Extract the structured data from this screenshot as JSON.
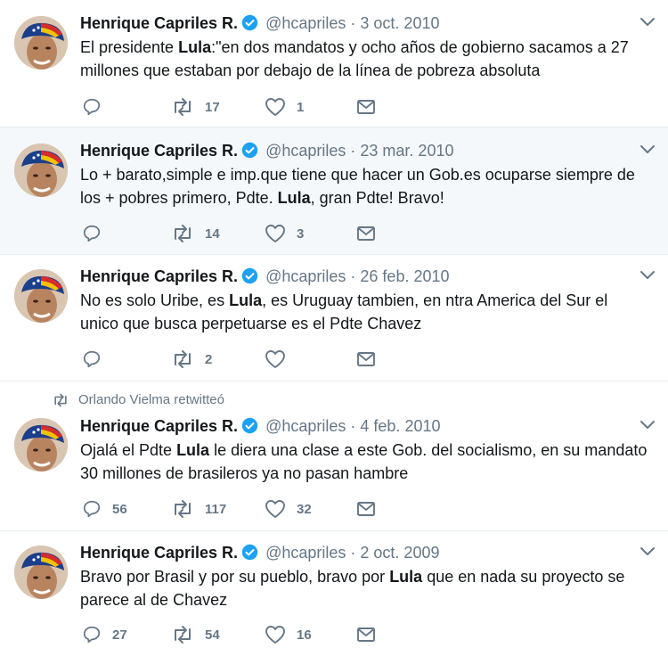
{
  "feed": {
    "retweet_context": "Orlando Vielma retwitteó",
    "tweets": [
      {
        "name": "Henrique Capriles R.",
        "handle": "@hcapriles",
        "separator": "·",
        "date": "3 oct. 2010",
        "text_parts": [
          "El presidente ",
          "Lula",
          ":\"en dos mandatos y ocho años de gobierno sacamos a 27 millones que estaban por debajo de la línea de pobreza absoluta"
        ],
        "replies": "",
        "retweets": "17",
        "likes": "1"
      },
      {
        "name": "Henrique Capriles R.",
        "handle": "@hcapriles",
        "separator": "·",
        "date": "23 mar. 2010",
        "text_parts": [
          "Lo + barato,simple e imp.que tiene que hacer un Gob.es ocuparse siempre de los + pobres primero, Pdte. ",
          "Lula",
          ", gran Pdte! Bravo!"
        ],
        "replies": "",
        "retweets": "14",
        "likes": "3"
      },
      {
        "name": "Henrique Capriles R.",
        "handle": "@hcapriles",
        "separator": "·",
        "date": "26 feb. 2010",
        "text_parts": [
          "No es solo Uribe, es ",
          "Lula",
          ", es Uruguay tambien, en ntra America del Sur el unico que busca perpetuarse es el Pdte Chavez"
        ],
        "replies": "",
        "retweets": "2",
        "likes": ""
      },
      {
        "name": "Henrique Capriles R.",
        "handle": "@hcapriles",
        "separator": "·",
        "date": "4 feb. 2010",
        "text_parts": [
          "Ojalá el Pdte ",
          "Lula",
          " le diera una clase a este Gob. del socialismo, en su mandato 30 millones de brasileros ya no pasan hambre"
        ],
        "replies": "56",
        "retweets": "117",
        "likes": "32"
      },
      {
        "name": "Henrique Capriles R.",
        "handle": "@hcapriles",
        "separator": "·",
        "date": "2 oct. 2009",
        "text_parts": [
          "Bravo por Brasil y por su pueblo, bravo por ",
          "Lula",
          " que en nada su proyecto se parece al de Chavez"
        ],
        "replies": "27",
        "retweets": "54",
        "likes": "16"
      }
    ]
  },
  "colors": {
    "text": "#14171a",
    "muted": "#657786",
    "verified": "#1da1f2",
    "highlight_bg": "#f5f8fa",
    "divider": "#e6ecf0"
  },
  "icons": [
    "reply-icon",
    "retweet-icon",
    "like-icon",
    "dm-icon",
    "verified-icon",
    "chevron-down-icon"
  ]
}
